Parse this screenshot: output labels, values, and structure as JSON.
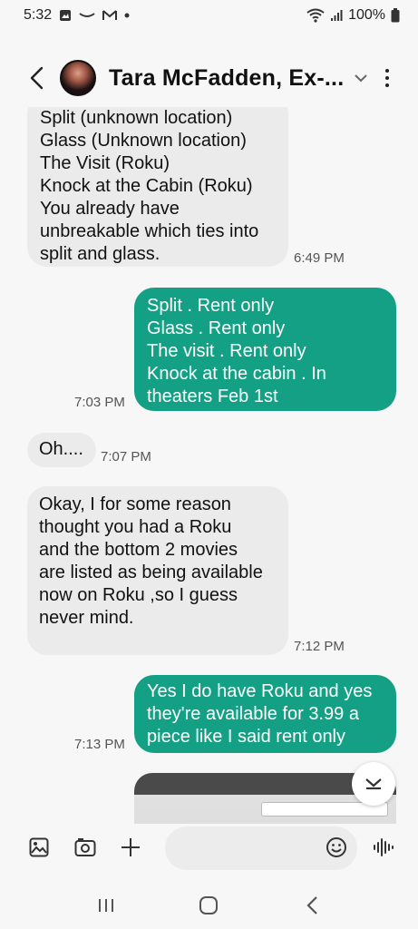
{
  "status_bar": {
    "time": "5:32",
    "battery": "100%"
  },
  "header": {
    "contact_name": "Tara McFadden, Ex-..."
  },
  "messages": [
    {
      "direction": "in",
      "text": "Split (unknown location)\nGlass (Unknown location)\nThe Visit (Roku)\nKnock at the Cabin (Roku)\nYou already have\nunbreakable which ties into\nsplit and glass.",
      "time": "6:49 PM"
    },
    {
      "direction": "out",
      "text": "Split . Rent only\nGlass . Rent only\nThe visit . Rent only\nKnock at the cabin . In\ntheaters Feb 1st",
      "time": "7:03 PM"
    },
    {
      "direction": "in",
      "text": "Oh....",
      "time": "7:07 PM"
    },
    {
      "direction": "in",
      "text": "Okay, I for some reason\nthought you had a Roku\nand the bottom 2 movies\nare listed as being available\nnow on Roku ,so I guess\nnever mind.",
      "time": "7:12 PM"
    },
    {
      "direction": "out",
      "text": "Yes I do have Roku and yes\nthey're available for 3.99 a\npiece like I said rent only",
      "time": "7:13 PM"
    }
  ],
  "composer": {
    "placeholder": ""
  },
  "colors": {
    "outgoing_bubble": "#14a085",
    "incoming_bubble": "#ebebeb",
    "background": "#f7f7f7"
  },
  "icons": [
    "gallery-icon",
    "camera-icon",
    "plus-icon",
    "emoji-icon",
    "voice-icon",
    "back-icon",
    "more-icon",
    "scroll-down-icon"
  ]
}
